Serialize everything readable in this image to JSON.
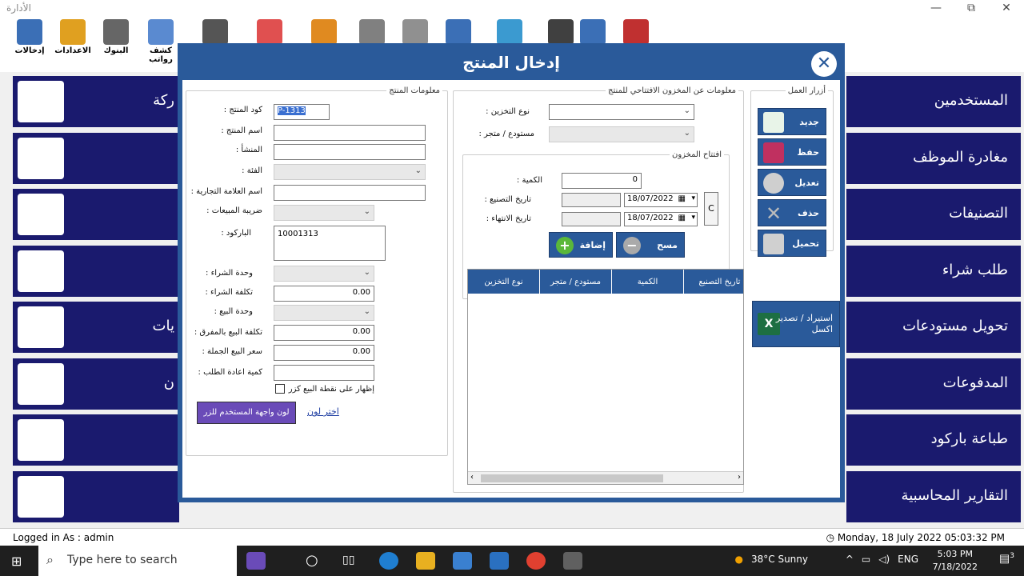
{
  "app": {
    "title": "الأدارة"
  },
  "window_controls": {
    "minimize": "—",
    "restore": "⧉",
    "close": "✕"
  },
  "toolbar": {
    "items": [
      {
        "label": "إدخالات",
        "icon": "entries-icon",
        "color": "#3b6fb6"
      },
      {
        "label": "الاعدادات",
        "icon": "settings-gear-icon",
        "color": "#e0a020"
      },
      {
        "label": "البنوك",
        "icon": "bank-icon",
        "color": "#666666"
      },
      {
        "label": "كشف رواتب",
        "icon": "payroll-icon",
        "color": "#5a8ad0"
      },
      {
        "label": "",
        "icon": "team-icon",
        "color": "#555555"
      },
      {
        "label": "",
        "icon": "transfer-icon",
        "color": "#e05050"
      },
      {
        "label": "",
        "icon": "cards-icon",
        "color": "#e08a20"
      },
      {
        "label": "",
        "icon": "staff-icon",
        "color": "#808080"
      },
      {
        "label": "",
        "icon": "documents-icon",
        "color": "#909090"
      },
      {
        "label": "",
        "icon": "report-icon",
        "color": "#3b6fb6"
      },
      {
        "label": "",
        "icon": "database-icon",
        "color": "#3b9ad0"
      },
      {
        "label": "",
        "icon": "tools-icon",
        "color": "#404040"
      },
      {
        "label": "",
        "icon": "help-icon",
        "color": "#3b6fb6"
      },
      {
        "label": "",
        "icon": "exit-icon",
        "color": "#c03030"
      }
    ]
  },
  "side_menu_right": [
    {
      "label": "المستخدمين"
    },
    {
      "label": "مغادرة الموظف"
    },
    {
      "label": "التصنيفات"
    },
    {
      "label": "طلب شراء"
    },
    {
      "label": "تحويل مستودعات"
    },
    {
      "label": "المدفوعات"
    },
    {
      "label": "طباعة باركود"
    },
    {
      "label": "التقارير المحاسبية"
    }
  ],
  "tiles_left": [
    {
      "label": "ركة",
      "icon": "building-icon"
    },
    {
      "label": "",
      "icon": "folders-icon"
    },
    {
      "label": "",
      "icon": "calculator-icon"
    },
    {
      "label": "",
      "icon": "shopping-cart-icon"
    },
    {
      "label": "يات",
      "icon": "shopping-bags-icon"
    },
    {
      "label": "ن",
      "icon": "chart-growth-icon"
    },
    {
      "label": "",
      "icon": "invoice-icon"
    },
    {
      "label": "",
      "icon": "support-icon"
    }
  ],
  "dialog": {
    "title": "إدخال المنتج",
    "close_icon": "✕",
    "product_info": {
      "legend": "معلومات المنتج",
      "product_code_label": ": كود المنتج",
      "product_code_value": "P-1313",
      "product_name_label": ": اسم المنتج",
      "origin_label": ": المنشأ",
      "category_label": ": الفئة",
      "brand_label": ": اسم العلامة التجارية",
      "sales_tax_label": ": ضريبة المبيعات",
      "barcode_label": ": الباركود",
      "barcode_value": "10001313",
      "purchase_unit_label": ": وحدة الشراء",
      "purchase_cost_label": ": تكلفة الشراء",
      "purchase_cost_value": "0.00",
      "sale_unit_label": ": وحدة البيع",
      "retail_cost_label": ": تكلفة البيع بالمفرق",
      "retail_cost_value": "0.00",
      "wholesale_price_label": ": سعر البيع الجملة",
      "wholesale_price_value": "0.00",
      "reorder_qty_label": ": كمية اعادة الطلب",
      "show_pos_label": "إظهار على نقطة البيع كزر",
      "ui_color_button": "لون واجهة المستخدم للزر",
      "choose_color_link": "اختر لون"
    },
    "opening_stock": {
      "legend": "معلومات عن المخزون الافتتاحي للمنتج",
      "storage_type_label": ": نوع التخزين",
      "warehouse_label": ": مستودع / متجر",
      "opening_group": {
        "legend": "افتتاح المخزون",
        "qty_label": ": الكمية",
        "qty_value": "0",
        "mfg_date_label": ": تاريخ التصنيع",
        "mfg_date_value": "18/07/2022",
        "exp_date_label": ": تاريخ الانتهاء",
        "exp_date_value": "18/07/2022",
        "c_button": "C",
        "add_button": "إضافة",
        "clear_button": "مسح"
      },
      "grid_headers": [
        "نوع التخزين",
        "مستودع / متجر",
        "الكمية",
        "تاريخ التصنيع"
      ]
    },
    "action_buttons": {
      "legend": "أزرار العمل",
      "new": "جديد",
      "save": "حفظ",
      "edit": "تعديل",
      "delete": "حذف",
      "load": "تحميل",
      "import_export": "استيراد / تصدير اكسل"
    }
  },
  "status": {
    "logged_in": "Logged in As :  admin",
    "datetime": "Monday, 18 July 2022 05:03:32 PM"
  },
  "taskbar": {
    "search_placeholder": "Type here to search",
    "weather": "38°C  Sunny",
    "lang": "ENG",
    "time": "5:03 PM",
    "date": "7/18/2022",
    "notifications": "3"
  }
}
